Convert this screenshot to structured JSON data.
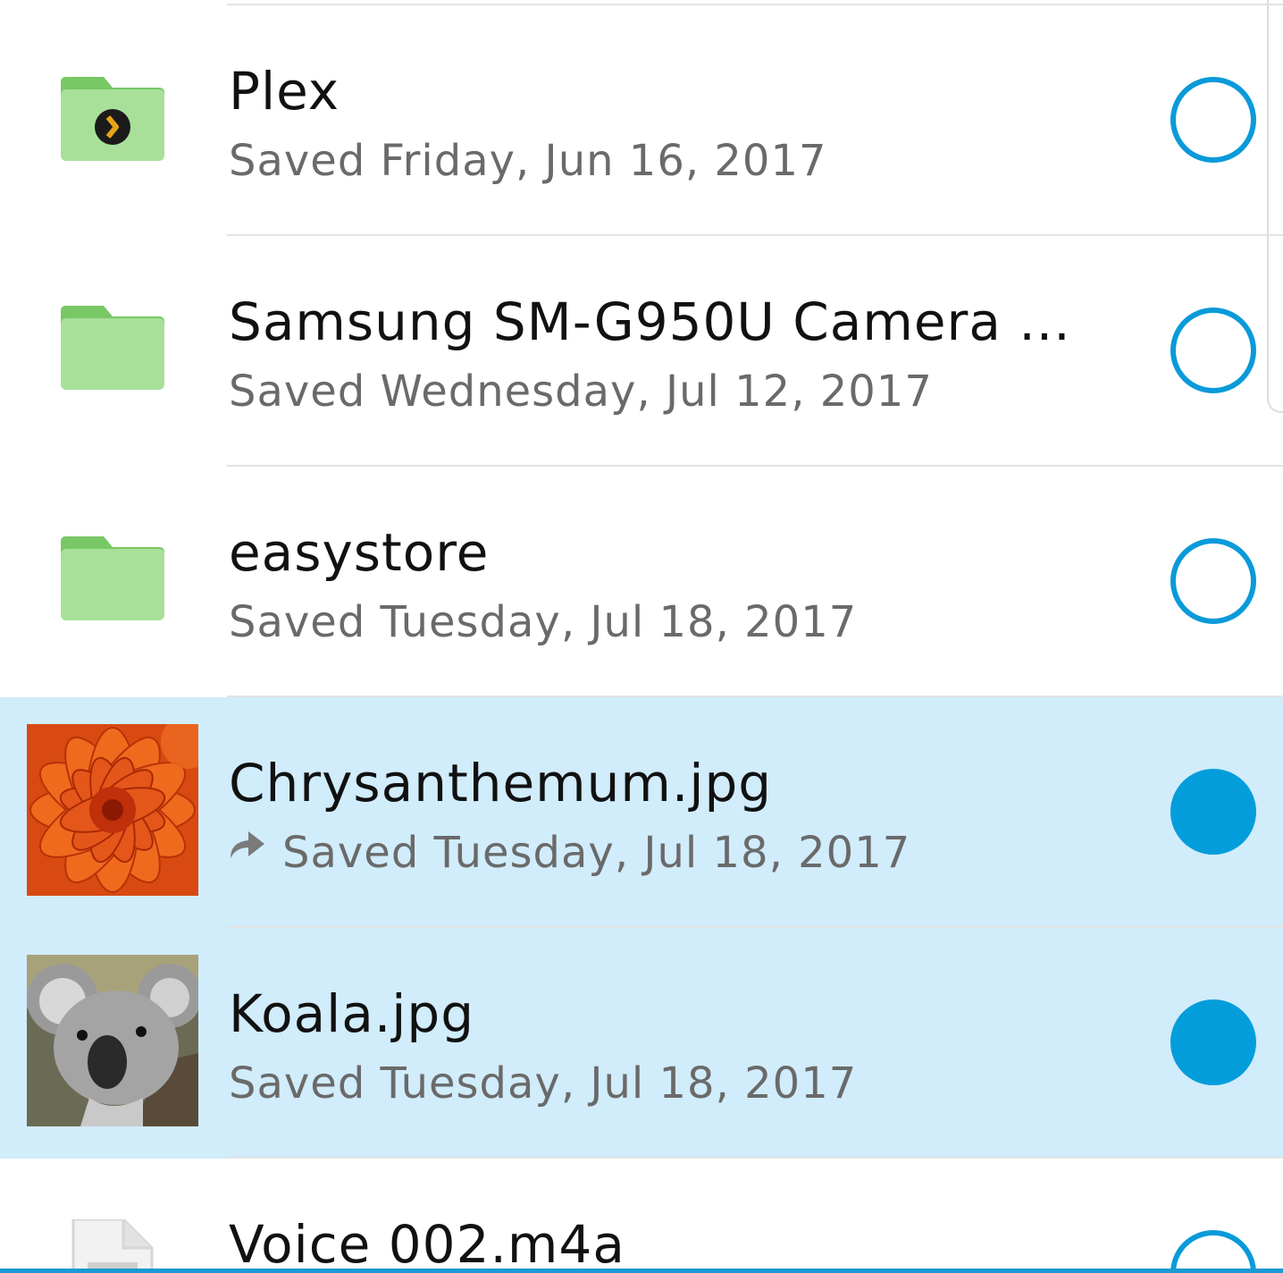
{
  "colors": {
    "accent": "#049ddc",
    "selected_row": "#d1ecfb",
    "folder": "#a8e09a",
    "folder_tab": "#78c865"
  },
  "items": [
    {
      "name": "Plex",
      "saved": "Saved Friday, Jun 16, 2017",
      "icon": "plex-folder-icon",
      "selected": false
    },
    {
      "name": "Samsung SM-G950U Camera ...",
      "saved": "Saved Wednesday, Jul 12, 2017",
      "icon": "folder-icon",
      "selected": false
    },
    {
      "name": "easystore",
      "saved": "Saved Tuesday, Jul 18, 2017",
      "icon": "folder-icon",
      "selected": false
    },
    {
      "name": "Chrysanthemum.jpg",
      "saved": "Saved Tuesday, Jul 18, 2017",
      "icon": "image-thumbnail",
      "selected": true,
      "shared": true
    },
    {
      "name": "Koala.jpg",
      "saved": "Saved Tuesday, Jul 18, 2017",
      "icon": "image-thumbnail",
      "selected": true
    },
    {
      "name": "Voice 002.m4a",
      "icon": "file-icon",
      "selected": false
    }
  ]
}
